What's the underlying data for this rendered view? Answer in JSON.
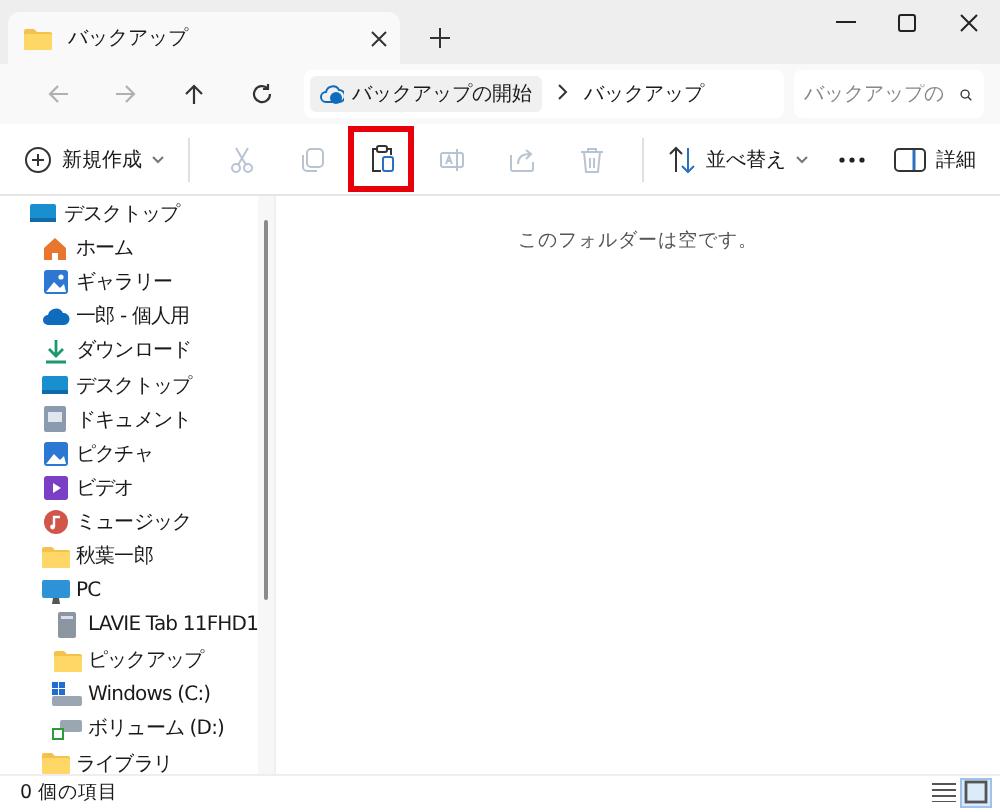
{
  "window": {
    "tab": {
      "title": "バックアップ",
      "selected": true
    }
  },
  "navigation": [
    {
      "kind": "back",
      "disabled": true
    },
    {
      "kind": "forward",
      "disabled": true
    },
    {
      "kind": "up",
      "disabled": false
    },
    {
      "kind": "refresh",
      "disabled": false
    }
  ],
  "address": {
    "crumbs": [
      "バックアップの開始",
      "バックアップ"
    ]
  },
  "search": {
    "placeholder": "バックアップの"
  },
  "toolbar": [
    {
      "kind": "new",
      "label": "新規作成",
      "disabled": false,
      "highlighted": false
    },
    {
      "kind": "cut",
      "disabled": true,
      "highlighted": false
    },
    {
      "kind": "copy",
      "disabled": true,
      "highlighted": false
    },
    {
      "kind": "paste",
      "disabled": false,
      "highlighted": true
    },
    {
      "kind": "rename",
      "disabled": true,
      "highlighted": false
    },
    {
      "kind": "share",
      "disabled": true,
      "highlighted": false
    },
    {
      "kind": "delete",
      "disabled": true,
      "highlighted": false
    },
    {
      "kind": "sort",
      "label": "並べ替え",
      "disabled": false,
      "highlighted": false
    },
    {
      "kind": "more",
      "disabled": false,
      "highlighted": false
    },
    {
      "kind": "details",
      "label": "詳細",
      "disabled": false,
      "highlighted": false
    }
  ],
  "sidebar": {
    "items": [
      {
        "kind": "desktop",
        "label": "デスクトップ",
        "children": [
          {
            "kind": "home",
            "label": "ホーム"
          },
          {
            "kind": "gallery",
            "label": "ギャラリー"
          },
          {
            "kind": "cloud",
            "label": "一郎 - 個人用"
          },
          {
            "kind": "download",
            "label": "ダウンロード"
          },
          {
            "kind": "desktop",
            "label": "デスクトップ"
          },
          {
            "kind": "documents",
            "label": "ドキュメント"
          },
          {
            "kind": "pictures",
            "label": "ピクチャ"
          },
          {
            "kind": "videos",
            "label": "ビデオ"
          },
          {
            "kind": "music",
            "label": "ミュージック"
          },
          {
            "kind": "folder",
            "label": "秋葉一郎"
          },
          {
            "kind": "pc",
            "label": "PC",
            "children": [
              {
                "kind": "device",
                "label": "LAVIE Tab 11FHD1"
              },
              {
                "kind": "folder",
                "label": "ピックアップ"
              },
              {
                "kind": "windows",
                "label": "Windows (C:)"
              },
              {
                "kind": "volume",
                "label": "ボリューム (D:)"
              }
            ]
          },
          {
            "kind": "folder",
            "label": "ライブラリ"
          }
        ]
      }
    ]
  },
  "content": {
    "empty_message": "このフォルダーは空です。"
  },
  "status_bar": {
    "count": "0 個の項目",
    "views": [
      {
        "kind": "list",
        "selected": false
      },
      {
        "kind": "tiles",
        "selected": true
      }
    ]
  }
}
